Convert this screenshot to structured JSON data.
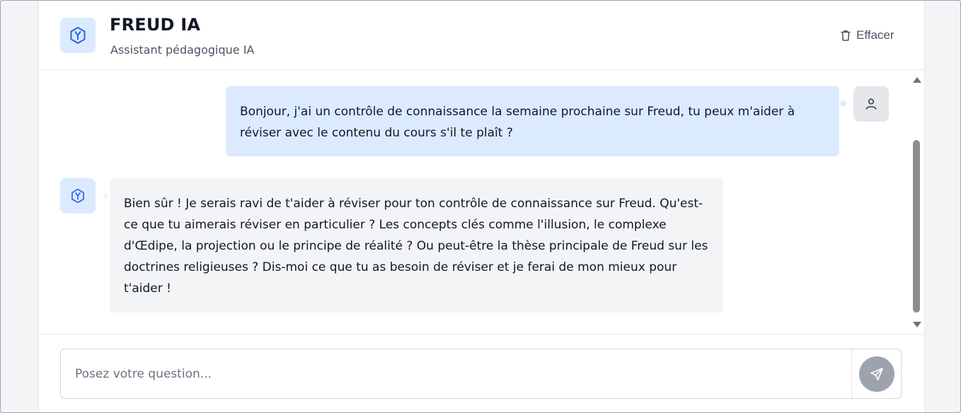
{
  "header": {
    "title": "FREUD IA",
    "subtitle": "Assistant pédagogique IA",
    "clear_label": "Effacer",
    "logo_icon": "hexagon-y-icon",
    "clear_icon": "trash-icon"
  },
  "messages": [
    {
      "role": "user",
      "text": "Bonjour, j'ai un contrôle de connaissance la semaine prochaine sur Freud, tu peux m'aider à réviser avec le contenu du cours s'il te plaît ?",
      "avatar_icon": "user-icon"
    },
    {
      "role": "assistant",
      "text": "Bien sûr ! Je serais ravi de t'aider à réviser pour ton contrôle de connaissance sur Freud. Qu'est-ce que tu aimerais réviser en particulier ? Les concepts clés comme l'illusion, le complexe d'Œdipe, la projection ou le principe de réalité ? Ou peut-être la thèse principale de Freud sur les doctrines religieuses ? Dis-moi ce que tu as besoin de réviser et je ferai de mon mieux pour t'aider !",
      "avatar_icon": "hexagon-y-icon"
    }
  ],
  "composer": {
    "placeholder": "Posez votre question...",
    "value": "",
    "send_icon": "send-icon"
  },
  "colors": {
    "accent": "#2563eb",
    "user_bubble": "#dbeafe",
    "assistant_bubble": "#f3f4f6",
    "send_button": "#9ca3af"
  }
}
